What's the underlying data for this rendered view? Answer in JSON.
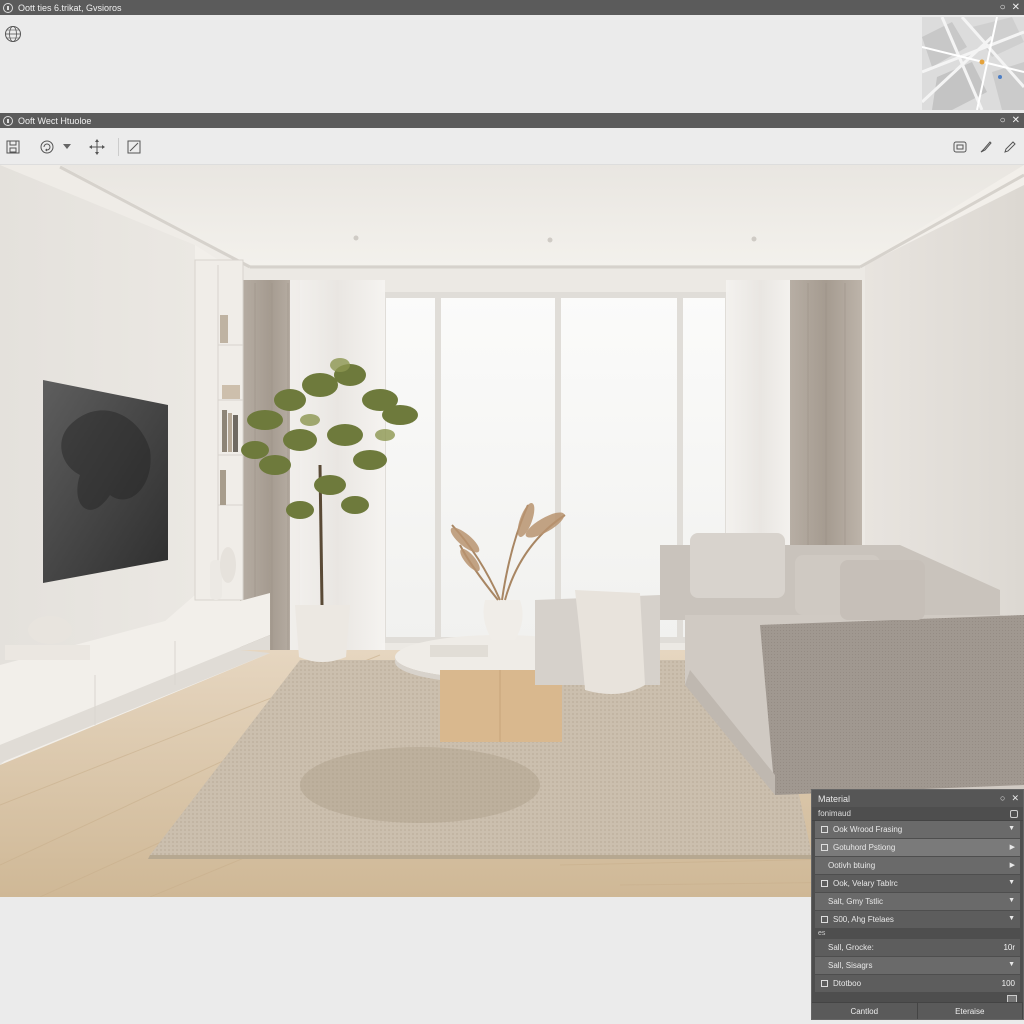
{
  "window1": {
    "title": "Oott ties 6.trikat, Gvsioros",
    "controls": [
      "○",
      "✕"
    ]
  },
  "window2": {
    "title": "Ooft Wect Htuoloe",
    "controls": [
      "○",
      "✕"
    ]
  },
  "icons": {
    "globe": "globe-icon",
    "minimap": "map-thumbnail",
    "tools_left": [
      "save-icon",
      "rotate-icon",
      "dropdown-icon",
      "move-icon",
      "edit-icon"
    ],
    "tools_right": [
      "screen-icon",
      "brush-icon",
      "pencil-icon"
    ]
  },
  "material_panel": {
    "title": "Material",
    "subtitle": "fonimaud",
    "rows": [
      {
        "label": "Ook Wrood Frasing",
        "style": "alt"
      },
      {
        "label": "Gotuhord Pstiong",
        "style": "sel"
      },
      {
        "label": "Ootivh btuing",
        "style": "alt"
      },
      {
        "label": "Ook, Velary Tablrc",
        "style": ""
      },
      {
        "label": "Salt, Gmy Tstlic",
        "style": "alt"
      },
      {
        "label": "S00, Ahg Ftelaes",
        "style": ""
      }
    ],
    "gap_label": "es",
    "value_rows": [
      {
        "label": "Sall, Grocke:",
        "value": "10r"
      },
      {
        "label": "Sall, Sisagrs",
        "value": ""
      },
      {
        "label": "Dtotboo",
        "value": "100"
      }
    ],
    "footer": [
      "Cantlod",
      "Eteraise"
    ]
  },
  "colors": {
    "titlebar": "#5b5b5b",
    "panel": "#4e4e4e",
    "wall": "#e8e4dd",
    "floor": "#d9c7ad"
  }
}
